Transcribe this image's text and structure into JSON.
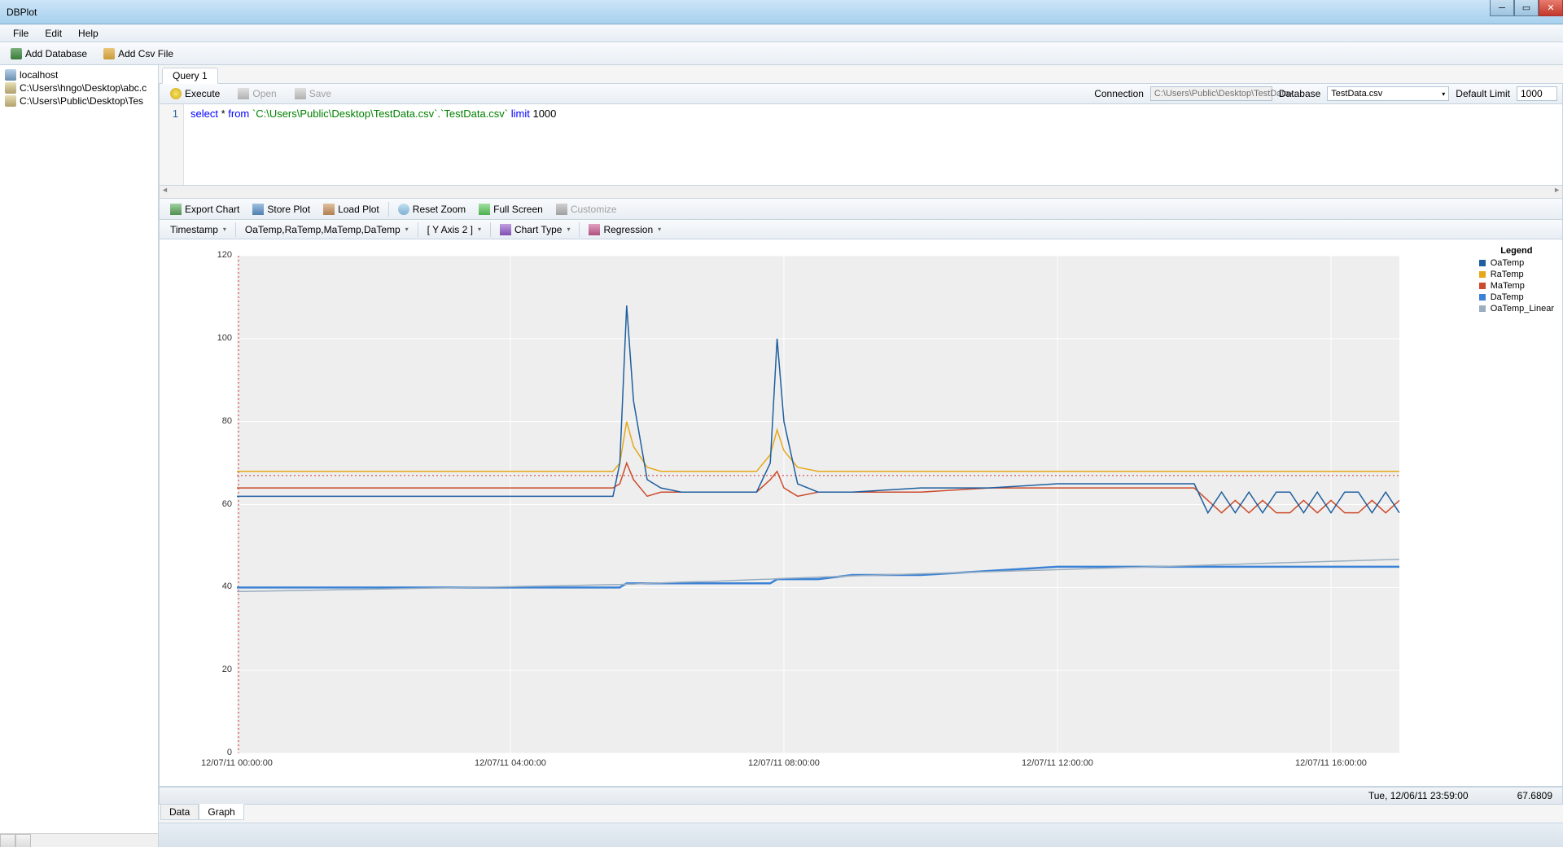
{
  "app_title": "DBPlot",
  "menu": {
    "file": "File",
    "edit": "Edit",
    "help": "Help"
  },
  "toolbar": {
    "add_db": "Add Database",
    "add_csv": "Add Csv File"
  },
  "tree": {
    "items": [
      {
        "label": "localhost",
        "type": "server"
      },
      {
        "label": "C:\\Users\\hngo\\Desktop\\abc.c",
        "type": "file"
      },
      {
        "label": "C:\\Users\\Public\\Desktop\\Tes",
        "type": "file"
      }
    ]
  },
  "tabs": {
    "query1": "Query 1"
  },
  "qtoolbar": {
    "execute": "Execute",
    "open": "Open",
    "save": "Save",
    "connection_label": "Connection",
    "connection_value": "C:\\Users\\Public\\Desktop\\TestData",
    "database_label": "Database",
    "database_value": "TestData.csv",
    "limit_label": "Default Limit",
    "limit_value": "1000"
  },
  "editor": {
    "line_no": "1",
    "kw_select": "select",
    "star": " * ",
    "kw_from": "from",
    "path": " `C:\\Users\\Public\\Desktop\\TestData.csv`.`TestData.csv` ",
    "kw_limit": "limit",
    "num": " 1000"
  },
  "ctoolbar": {
    "export": "Export Chart",
    "store": "Store Plot",
    "load": "Load Plot",
    "reset": "Reset Zoom",
    "full": "Full Screen",
    "customize": "Customize"
  },
  "ctoolbar2": {
    "x": "Timestamp",
    "y": "OaTemp,RaTemp,MaTemp,DaTemp",
    "y2": "[ Y Axis 2 ]",
    "chart_type": "Chart Type",
    "regression": "Regression"
  },
  "legend": {
    "title": "Legend",
    "items": [
      {
        "name": "OaTemp",
        "color": "#1f5f9f"
      },
      {
        "name": "RaTemp",
        "color": "#e6a817"
      },
      {
        "name": "MaTemp",
        "color": "#cc4b2c"
      },
      {
        "name": "DaTemp",
        "color": "#3b82d6"
      },
      {
        "name": "OaTemp_Linear",
        "color": "#9aaec0"
      }
    ]
  },
  "status": {
    "time": "Tue, 12/06/11 23:59:00",
    "value": "67.6809"
  },
  "bottom_tabs": {
    "data": "Data",
    "graph": "Graph"
  },
  "chart_data": {
    "type": "line",
    "xlabel": "",
    "ylabel": "",
    "ylim": [
      0,
      120
    ],
    "x_ticks": [
      "12/07/11 00:00:00",
      "12/07/11 04:00:00",
      "12/07/11 08:00:00",
      "12/07/11 12:00:00",
      "12/07/11 16:00:00"
    ],
    "y_ticks": [
      0,
      20,
      40,
      60,
      80,
      100,
      120
    ],
    "x": [
      0,
      1,
      2,
      3,
      4,
      5,
      5.5,
      5.6,
      5.7,
      5.8,
      6,
      6.2,
      6.5,
      7,
      7.6,
      7.8,
      7.9,
      8,
      8.2,
      8.5,
      9,
      10,
      11,
      12,
      13,
      14,
      14.2,
      14.4,
      14.6,
      14.8,
      15,
      15.2,
      15.4,
      15.6,
      15.8,
      16,
      16.2,
      16.4,
      16.6,
      16.8,
      17
    ],
    "series": [
      {
        "name": "RaTemp",
        "color": "#e6a817",
        "values": [
          68,
          68,
          68,
          68,
          68,
          68,
          68,
          70,
          80,
          74,
          69,
          68,
          68,
          68,
          68,
          72,
          78,
          73,
          69,
          68,
          68,
          68,
          68,
          68,
          68,
          68,
          68,
          68,
          68,
          68,
          68,
          68,
          68,
          68,
          68,
          68,
          68,
          68,
          68,
          68,
          68
        ]
      },
      {
        "name": "MaTemp",
        "color": "#cc4b2c",
        "values": [
          64,
          64,
          64,
          64,
          64,
          64,
          64,
          65,
          70,
          66,
          62,
          63,
          63,
          63,
          63,
          66,
          68,
          64,
          62,
          63,
          63,
          63,
          64,
          64,
          64,
          64,
          61,
          58,
          61,
          58,
          61,
          58,
          58,
          61,
          58,
          61,
          58,
          58,
          61,
          58,
          61
        ]
      },
      {
        "name": "OaTemp",
        "color": "#1f5f9f",
        "values": [
          62,
          62,
          62,
          62,
          62,
          62,
          62,
          70,
          108,
          85,
          66,
          64,
          63,
          63,
          63,
          70,
          100,
          80,
          65,
          63,
          63,
          64,
          64,
          65,
          65,
          65,
          58,
          63,
          58,
          63,
          58,
          63,
          63,
          58,
          63,
          58,
          63,
          63,
          58,
          63,
          58
        ]
      },
      {
        "name": "DaTemp",
        "color": "#3b82d6",
        "values": [
          40,
          40,
          40,
          40,
          40,
          40,
          40,
          40,
          41,
          41,
          41,
          41,
          41,
          41,
          41,
          41,
          42,
          42,
          42,
          42,
          43,
          43,
          44,
          45,
          45,
          45,
          45,
          45,
          45,
          45,
          45,
          45,
          45,
          45,
          45,
          45,
          45,
          45,
          45,
          45,
          45
        ]
      },
      {
        "name": "OaTemp_Linear",
        "color": "#9aaec0",
        "values": [
          39,
          39.3,
          39.6,
          39.9,
          40.2,
          40.5,
          40.7,
          40.7,
          40.8,
          40.8,
          41,
          41.1,
          41.3,
          41.5,
          41.9,
          42,
          42.1,
          42.2,
          42.3,
          42.5,
          42.8,
          43.3,
          43.8,
          44.3,
          44.8,
          45.3,
          45.4,
          45.5,
          45.6,
          45.7,
          45.8,
          45.9,
          46,
          46.1,
          46.2,
          46.3,
          46.4,
          46.5,
          46.6,
          46.7,
          46.8
        ]
      }
    ]
  }
}
